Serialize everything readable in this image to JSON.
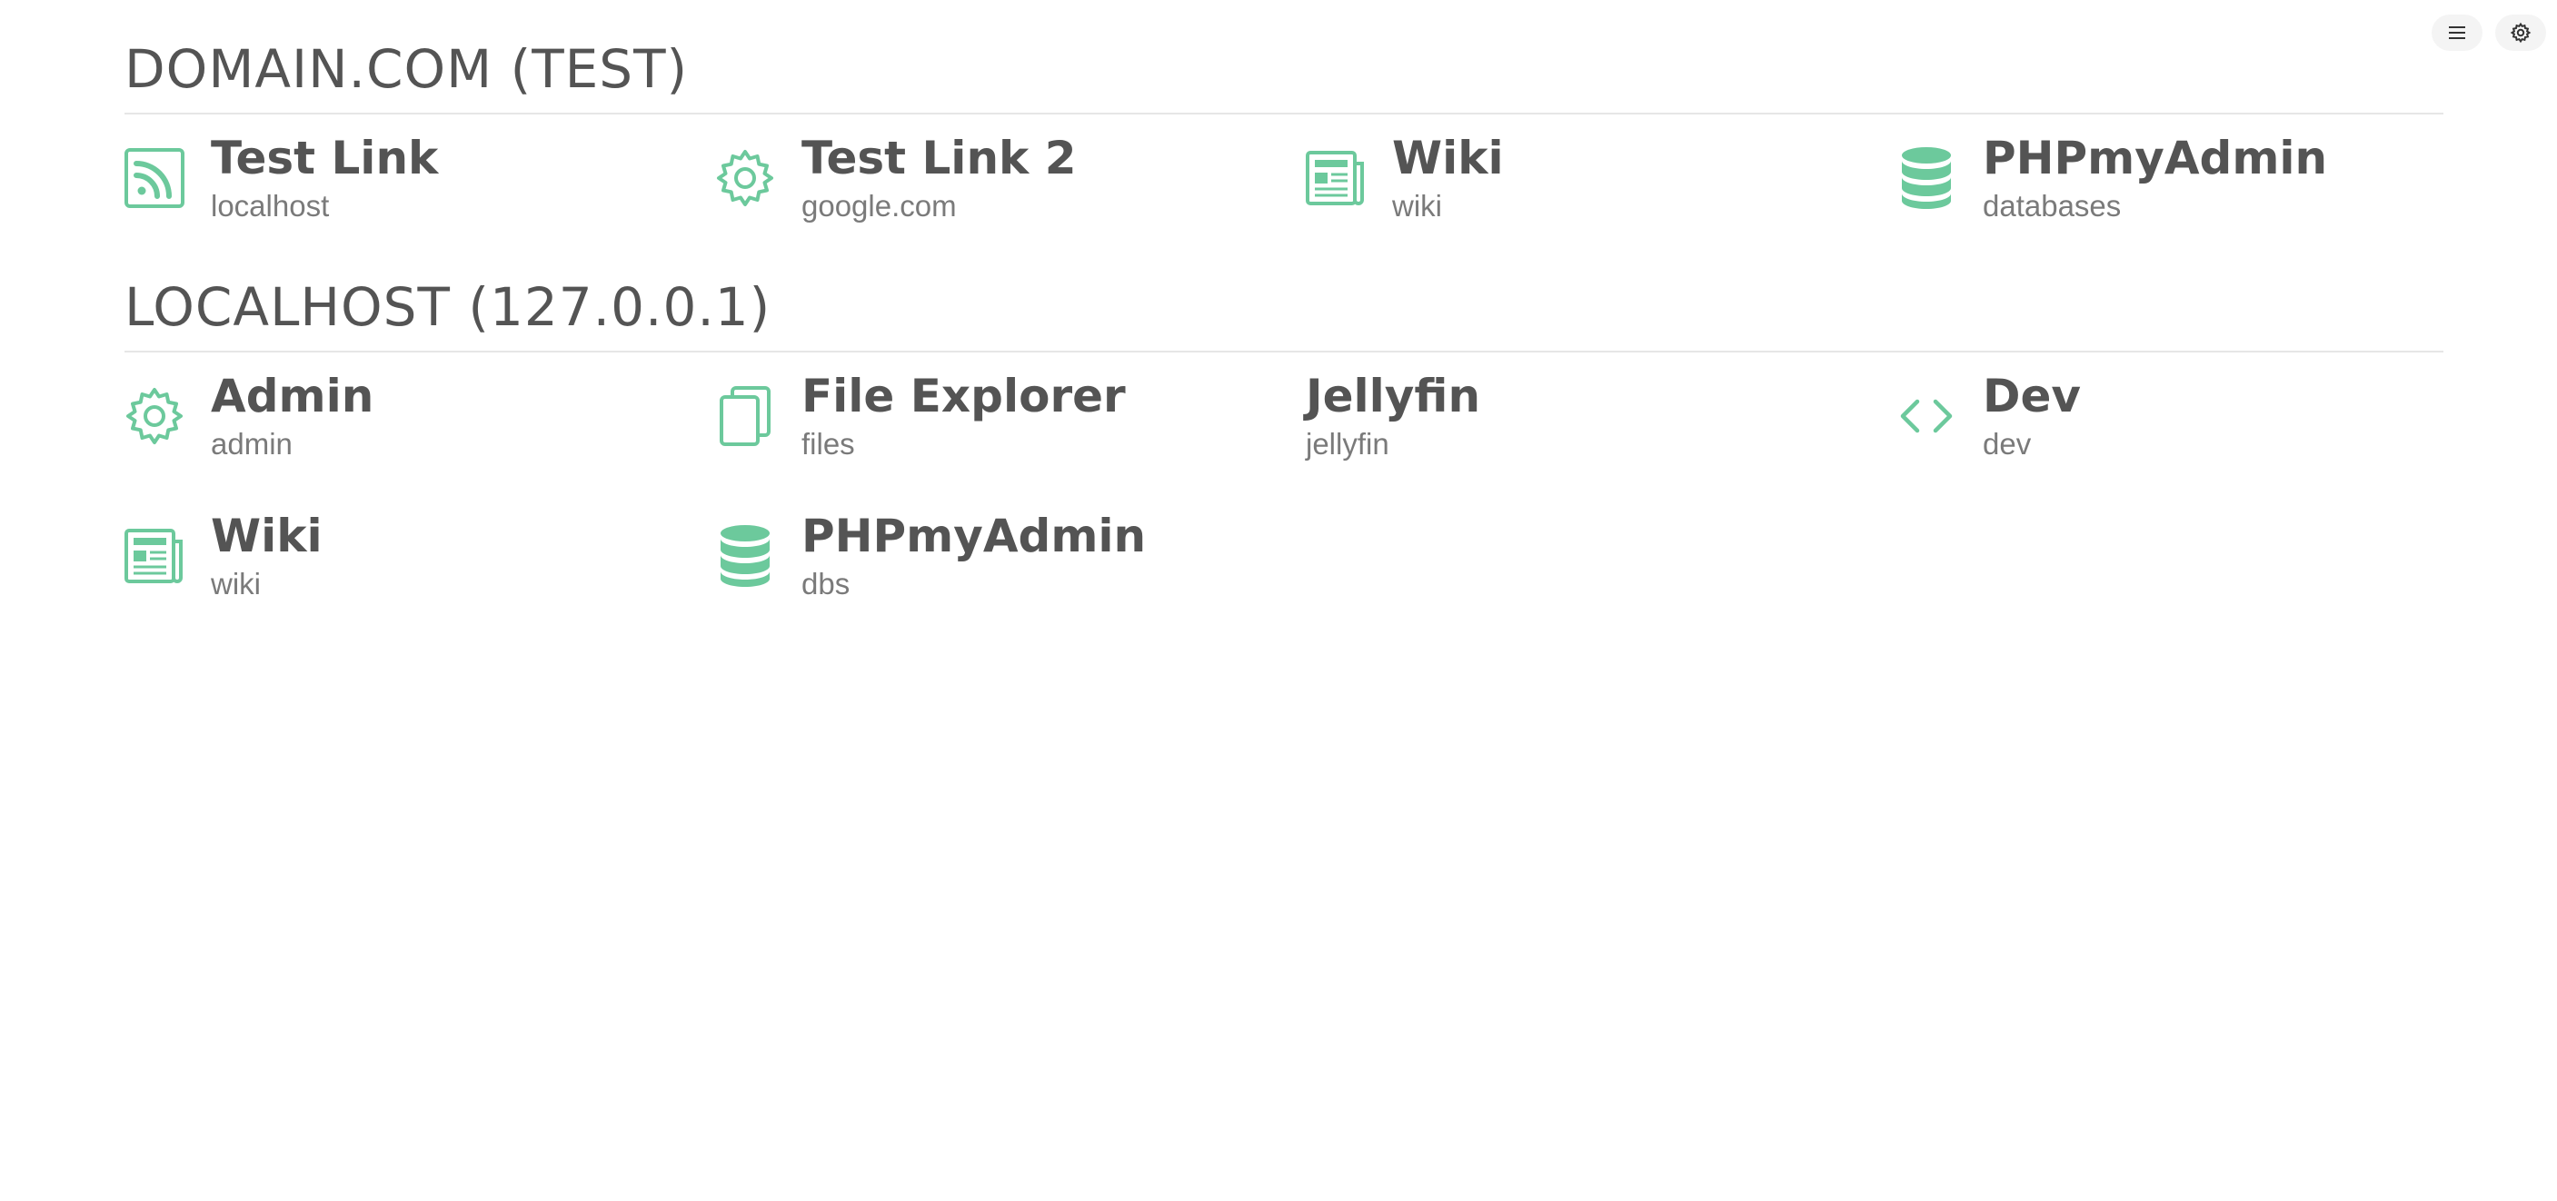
{
  "header": {
    "menu_icon": "hamburger-menu-icon",
    "settings_icon": "gear-icon"
  },
  "accent_color": "#6cc99c",
  "groups": [
    {
      "title": "DOMAIN.COM (TEST)",
      "items": [
        {
          "title": "Test Link",
          "subtitle": "localhost",
          "icon": "rss-icon"
        },
        {
          "title": "Test Link 2",
          "subtitle": "google.com",
          "icon": "gear-icon"
        },
        {
          "title": "Wiki",
          "subtitle": "wiki",
          "icon": "newspaper-icon"
        },
        {
          "title": "PHPmyAdmin",
          "subtitle": "databases",
          "icon": "database-icon"
        }
      ]
    },
    {
      "title": "LOCALHOST (127.0.0.1)",
      "items": [
        {
          "title": "Admin",
          "subtitle": "admin",
          "icon": "gear-icon"
        },
        {
          "title": "File Explorer",
          "subtitle": "files",
          "icon": "files-icon"
        },
        {
          "title": "Jellyfin",
          "subtitle": "jellyfin",
          "icon": ""
        },
        {
          "title": "Dev",
          "subtitle": "dev",
          "icon": "code-icon"
        },
        {
          "title": "Wiki",
          "subtitle": "wiki",
          "icon": "newspaper-icon"
        },
        {
          "title": "PHPmyAdmin",
          "subtitle": "dbs",
          "icon": "database-icon"
        }
      ]
    }
  ]
}
